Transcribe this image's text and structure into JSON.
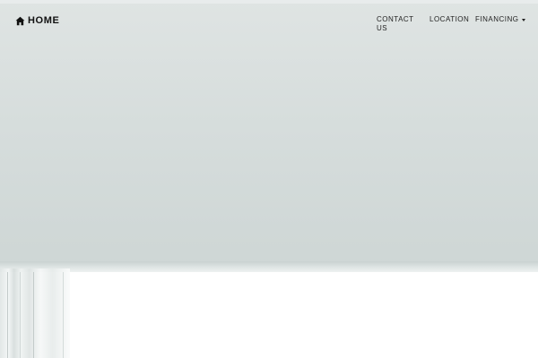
{
  "navbar": {
    "brand": {
      "icon": "home-icon",
      "label": "HOME"
    },
    "links": {
      "contact": "CONTACT US",
      "location": "LOCATION",
      "financing": "FINANCING",
      "financing_icon": "caret-down-icon"
    }
  },
  "colors": {
    "text": "#111111",
    "background_top": "#dfe4e3",
    "background_bottom": "#ffffff"
  }
}
